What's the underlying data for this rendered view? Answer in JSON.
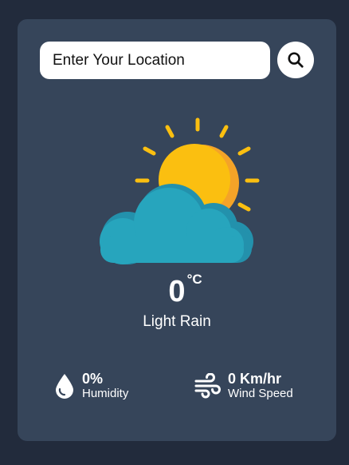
{
  "search": {
    "placeholder": "Enter Your Location",
    "value": ""
  },
  "weather": {
    "icon": "partly-cloudy-sun-icon",
    "temperature": "0",
    "unit": "°C",
    "description": "Light Rain"
  },
  "details": {
    "humidity_value": "0%",
    "humidity_label": "Humidity",
    "wind_value": "0 Km/hr",
    "wind_label": "Wind Speed"
  },
  "colors": {
    "page_bg": "#222b3c",
    "card_bg": "#36455a",
    "sun": "#fbbf10",
    "cloud": "#27a5bd"
  }
}
